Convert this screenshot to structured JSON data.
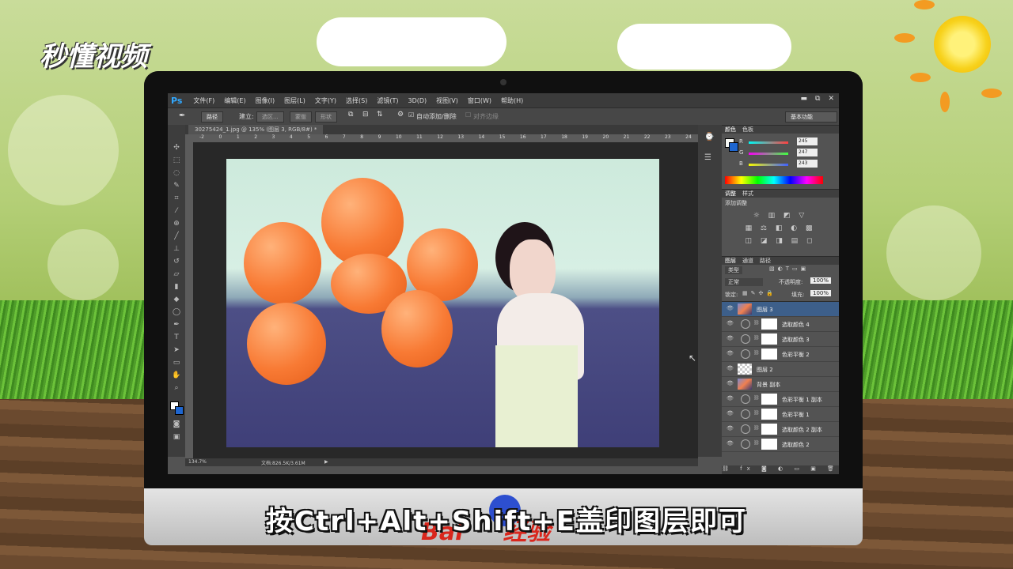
{
  "watermark": {
    "brand": "秒懂视频"
  },
  "subtitle": {
    "text": "按Ctrl+Alt+Shift+E盖印图层即可"
  },
  "baidu_logo": {
    "text": "Bai",
    "suffix": "经验"
  },
  "ps": {
    "app_icon": "Ps",
    "menu": [
      "文件(F)",
      "编辑(E)",
      "图像(I)",
      "图层(L)",
      "文字(Y)",
      "选择(S)",
      "滤镜(T)",
      "3D(D)",
      "视图(V)",
      "窗口(W)",
      "帮助(H)"
    ],
    "window_controls": {
      "minimize": "▬",
      "restore": "⧉",
      "close": "✕"
    },
    "options": {
      "mode": "路径",
      "build_label": "建立:",
      "selection_btn": "选区...",
      "mask_btn": "蒙版",
      "shape_btn": "形状",
      "auto_add_delete": "自动添加/删除",
      "align_edges": "对齐边缘",
      "workspace": "基本功能"
    },
    "document_tab": "30275424_1.jpg @ 135% (图层 3, RGB/8#) *",
    "ruler_ticks": [
      "-2",
      "0",
      "1",
      "2",
      "3",
      "4",
      "5",
      "6",
      "7",
      "8",
      "9",
      "10",
      "11",
      "12",
      "13",
      "14",
      "15",
      "16",
      "17",
      "18",
      "19",
      "20",
      "21",
      "22",
      "23",
      "24"
    ],
    "status": {
      "zoom": "134.7%",
      "doc": "文档:826.5K/3.61M"
    },
    "color_panel": {
      "tabs": [
        "颜色",
        "色板"
      ],
      "channels": [
        {
          "label": "R",
          "value": "245",
          "color": "#ff4040"
        },
        {
          "label": "G",
          "value": "247",
          "color": "#40ff40"
        },
        {
          "label": "B",
          "value": "243",
          "color": "#4060ff"
        }
      ]
    },
    "adjust_panel": {
      "tabs": [
        "调整",
        "样式"
      ],
      "title": "添加调整",
      "icons_row1": "☼ ▥ ◩ ▽",
      "icons_row2": "▦ ⚖ ◧ ◐ ▩",
      "icons_row3": "◫ ◪ ◨ ▤ ◻"
    },
    "layers_panel": {
      "tabs": [
        "图层",
        "通道",
        "路径"
      ],
      "filter": "类型",
      "blend_mode": "正常",
      "opacity_label": "不透明度:",
      "opacity": "100%",
      "lock_label": "锁定:",
      "fill_label": "填充:",
      "fill": "100%",
      "layers": [
        {
          "name": "图层 3",
          "type": "pixel",
          "selected": true
        },
        {
          "name": "选取颜色 4",
          "type": "adjustment"
        },
        {
          "name": "选取颜色 3",
          "type": "adjustment"
        },
        {
          "name": "色彩平衡 2",
          "type": "adjustment"
        },
        {
          "name": "图层 2",
          "type": "transparent"
        },
        {
          "name": "背景 副本",
          "type": "pixel"
        },
        {
          "name": "色彩平衡 1 副本",
          "type": "adjustment"
        },
        {
          "name": "色彩平衡 1",
          "type": "adjustment"
        },
        {
          "name": "选取颜色 2 副本",
          "type": "adjustment"
        },
        {
          "name": "选取颜色 2",
          "type": "adjustment"
        }
      ]
    }
  }
}
